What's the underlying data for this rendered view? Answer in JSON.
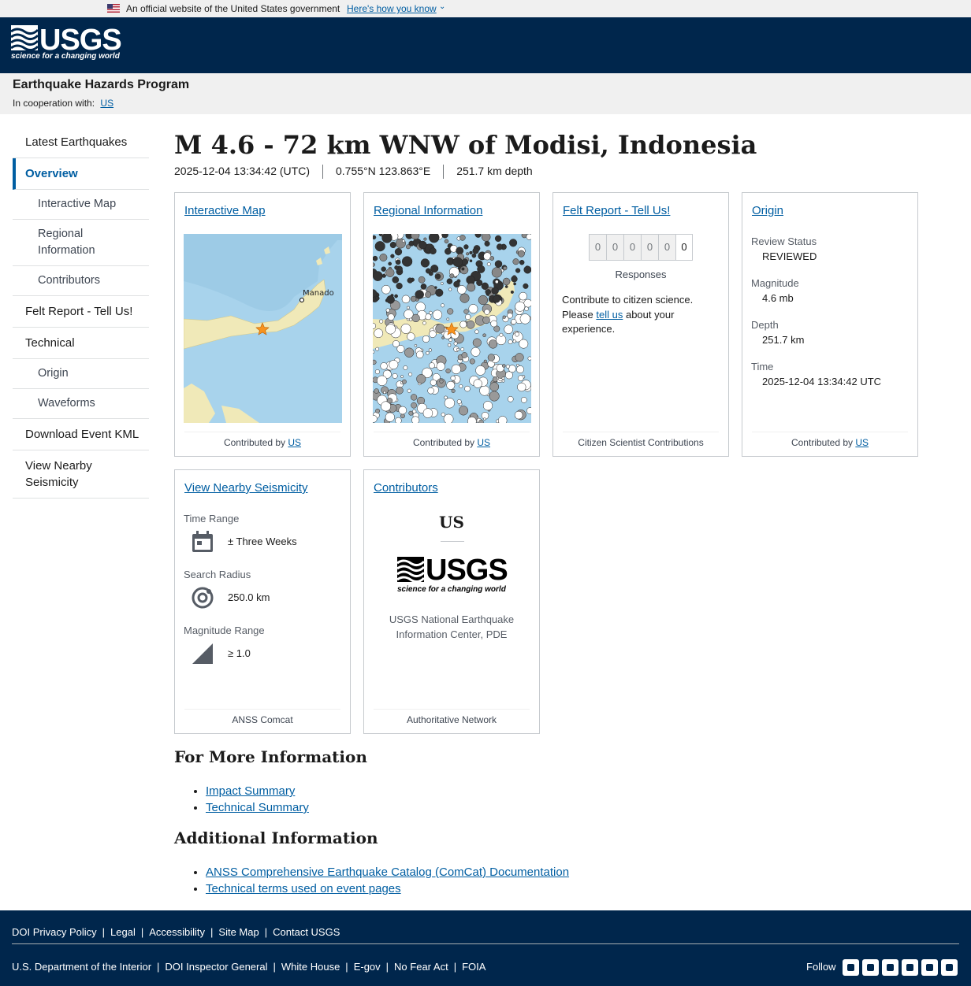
{
  "gov_banner": {
    "text": "An official website of the United States government",
    "link": "Here's how you know"
  },
  "header": {
    "logo_word": "USGS",
    "logo_tagline": "science for a changing world"
  },
  "program": {
    "name": "Earthquake Hazards Program",
    "coop_label": "In cooperation with:",
    "coop_link": "US"
  },
  "sidebar": {
    "items": [
      {
        "label": "Latest Earthquakes"
      },
      {
        "label": "Overview"
      },
      {
        "label": "Interactive Map"
      },
      {
        "label": "Regional Information"
      },
      {
        "label": "Contributors"
      },
      {
        "label": "Felt Report - Tell Us!"
      },
      {
        "label": "Technical"
      },
      {
        "label": "Origin"
      },
      {
        "label": "Waveforms"
      },
      {
        "label": "Download Event KML"
      },
      {
        "label": "View Nearby Seismicity"
      }
    ]
  },
  "event": {
    "title": "M 4.6 - 72 km WNW of Modisi, Indonesia",
    "time": "2025-12-04 13:34:42 (UTC)",
    "location": "0.755°N 123.863°E",
    "depth": "251.7 km depth"
  },
  "cards": {
    "interactive_map": {
      "title": "Interactive Map",
      "footer_text": "Contributed by",
      "footer_link": "US",
      "city": "Manado"
    },
    "regional": {
      "title": "Regional Information",
      "footer_text": "Contributed by",
      "footer_link": "US"
    },
    "felt": {
      "title": "Felt Report - Tell Us!",
      "digits": [
        "0",
        "0",
        "0",
        "0",
        "0",
        "0"
      ],
      "responses_label": "Responses",
      "text_before": "Contribute to citizen science. Please",
      "link": "tell us",
      "text_after": "about your experience.",
      "footer": "Citizen Scientist Contributions"
    },
    "origin": {
      "title": "Origin",
      "review_label": "Review Status",
      "review_value": "REVIEWED",
      "magnitude_label": "Magnitude",
      "magnitude_value": "4.6 mb",
      "depth_label": "Depth",
      "depth_value": "251.7 km",
      "time_label": "Time",
      "time_value": "2025-12-04 13:34:42 UTC",
      "footer_text": "Contributed by",
      "footer_link": "US"
    },
    "nearby": {
      "title": "View Nearby Seismicity",
      "time_label": "Time Range",
      "time_value": "± Three Weeks",
      "radius_label": "Search Radius",
      "radius_value": "250.0 km",
      "mag_label": "Magnitude Range",
      "mag_value": "≥ 1.0",
      "footer": "ANSS Comcat"
    },
    "contributors": {
      "title": "Contributors",
      "network": "US",
      "logo_word": "USGS",
      "logo_tagline": "science for a changing world",
      "name": "USGS National Earthquake Information Center, PDE",
      "footer": "Authoritative Network"
    }
  },
  "more_info": {
    "heading": "For More Information",
    "links": [
      "Impact Summary",
      "Technical Summary"
    ]
  },
  "additional_info": {
    "heading": "Additional Information",
    "links": [
      "ANSS Comprehensive Earthquake Catalog (ComCat) Documentation",
      "Technical terms used on event pages"
    ]
  },
  "footer": {
    "row1": [
      "DOI Privacy Policy",
      "Legal",
      "Accessibility",
      "Site Map",
      "Contact USGS"
    ],
    "row2": [
      "U.S. Department of the Interior",
      "DOI Inspector General",
      "White House",
      "E-gov",
      "No Fear Act",
      "FOIA"
    ],
    "follow": "Follow",
    "social_icons": [
      "twitter-icon",
      "facebook-icon",
      "github-icon",
      "flickr-icon",
      "youtube-icon",
      "instagram-icon"
    ]
  },
  "colors": {
    "header_bg": "#00264c",
    "link": "#005ea2",
    "map_water": "#a8d3ec",
    "map_land": "#f0e9b8",
    "epicenter_star": "#f7931e"
  }
}
